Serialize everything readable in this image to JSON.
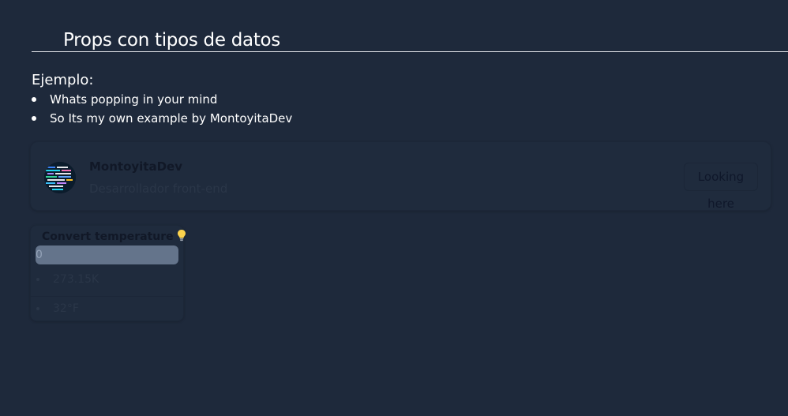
{
  "header": {
    "title": "Props con tipos de datos"
  },
  "example": {
    "label": "Ejemplo:",
    "items": [
      "Whats popping in your mind",
      "So Its my own example by MontoyitaDev"
    ]
  },
  "profile_card": {
    "name": "MontoyitaDev",
    "role": "Desarrollador front-end",
    "button_label": "Looking here",
    "avatar_icon": "avatar-image"
  },
  "temperature_card": {
    "title": "Convert temperature",
    "icon": "lightbulb-icon",
    "input_value": "0",
    "results": [
      "273.15K",
      "32°F"
    ]
  },
  "colors": {
    "background": "#1e293b",
    "input_background": "#64748b",
    "bulb": "#fcd34d"
  }
}
